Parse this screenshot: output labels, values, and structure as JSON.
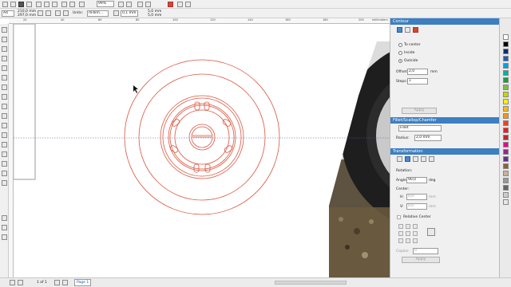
{
  "toolbar": {
    "zoom_value": "99%",
    "page_size": "A4",
    "width_value": "210,0 mm",
    "height_value": "297,0 mm",
    "units_label": "Units:",
    "units_value": "millim...",
    "nudge_value": "0,1 mm",
    "dup_x_value": "5,0 mm",
    "dup_y_value": "5,0 mm"
  },
  "ruler": {
    "ticks": [
      "20",
      "40",
      "60",
      "80",
      "100",
      "120",
      "140",
      "160",
      "180",
      "200"
    ],
    "units": "millimeters"
  },
  "status": {
    "page_counter": "1 of 1",
    "page_tab": "Page 1"
  },
  "contour": {
    "title": "Contour",
    "to_center": "To center",
    "inside": "Inside",
    "outside": "Outside",
    "offset_label": "Offset:",
    "offset_value": "2,0",
    "offset_unit": "mm",
    "steps_label": "Steps:",
    "steps_value": "1",
    "apply": "Apply"
  },
  "fillet": {
    "title": "Fillet/Scallop/Chamfer",
    "mode_value": "Fillet",
    "radius_label": "Radius:",
    "radius_value": "2,0 mm"
  },
  "transformation": {
    "title": "Transformation",
    "rotation_label": "Rotation:",
    "angle_label": "Angle:",
    "angle_value": "90,0",
    "angle_unit": "deg",
    "center_label": "Center:",
    "cx_label": "H:",
    "cx_value": "0,0",
    "cy_label": "V:",
    "cy_value": "0,0",
    "center_unit": "mm",
    "relative_center": "Relative Center",
    "copies_label": "Copies:",
    "copies_value": "0",
    "apply": "Apply"
  },
  "palette_colors": [
    "#ffffff",
    "#000000",
    "#0a2d6e",
    "#1b5fb3",
    "#00a0e0",
    "#00b3a0",
    "#1e9e3c",
    "#7ac143",
    "#c8d400",
    "#fff200",
    "#fdb913",
    "#f7941d",
    "#ef4123",
    "#ed1c24",
    "#c1272d",
    "#ec008c",
    "#92278f",
    "#662d91",
    "#8c6239",
    "#c7b299",
    "#999999",
    "#666666",
    "#cccccc",
    "#e6e6e6"
  ],
  "accent_color": "#3d7fc1",
  "drawing_color": "#d9553f"
}
